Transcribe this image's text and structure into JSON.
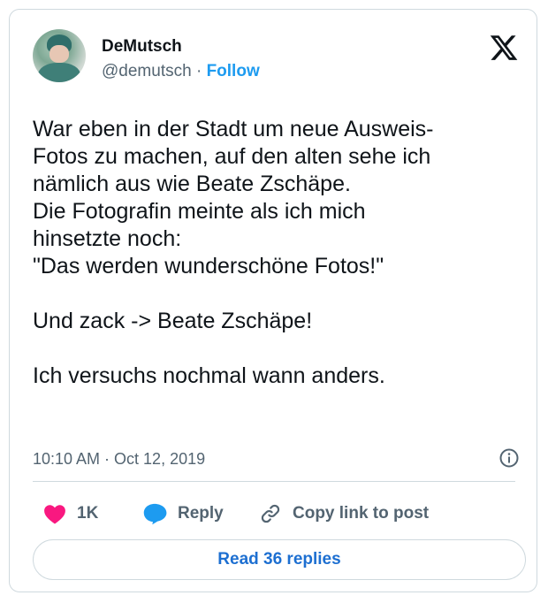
{
  "author": {
    "name": "DeMutsch",
    "handle": "@demutsch",
    "separator": "·",
    "follow_label": "Follow"
  },
  "tweet": {
    "text": "War eben in der Stadt um neue Ausweis-\nFotos zu machen, auf den alten sehe ich\nnämlich aus wie Beate Zschäpe.\nDie Fotografin meinte als ich mich\nhinsetzte noch:\n\"Das werden wunderschöne Fotos!\"\n\nUnd zack -> Beate Zschäpe!\n\nIch versuchs nochmal wann anders.",
    "timestamp": "10:10 AM · Oct 12, 2019"
  },
  "actions": {
    "likes_count": "1K",
    "reply_label": "Reply",
    "copy_label": "Copy link to post"
  },
  "read_replies_label": "Read 36 replies",
  "colors": {
    "accent": "#1d9bf0",
    "like": "#f91880",
    "text": "#0f1419",
    "muted": "#536471",
    "border": "#cfd9de"
  },
  "icons": [
    "x-logo-icon",
    "info-icon",
    "heart-icon",
    "reply-icon",
    "link-icon"
  ]
}
